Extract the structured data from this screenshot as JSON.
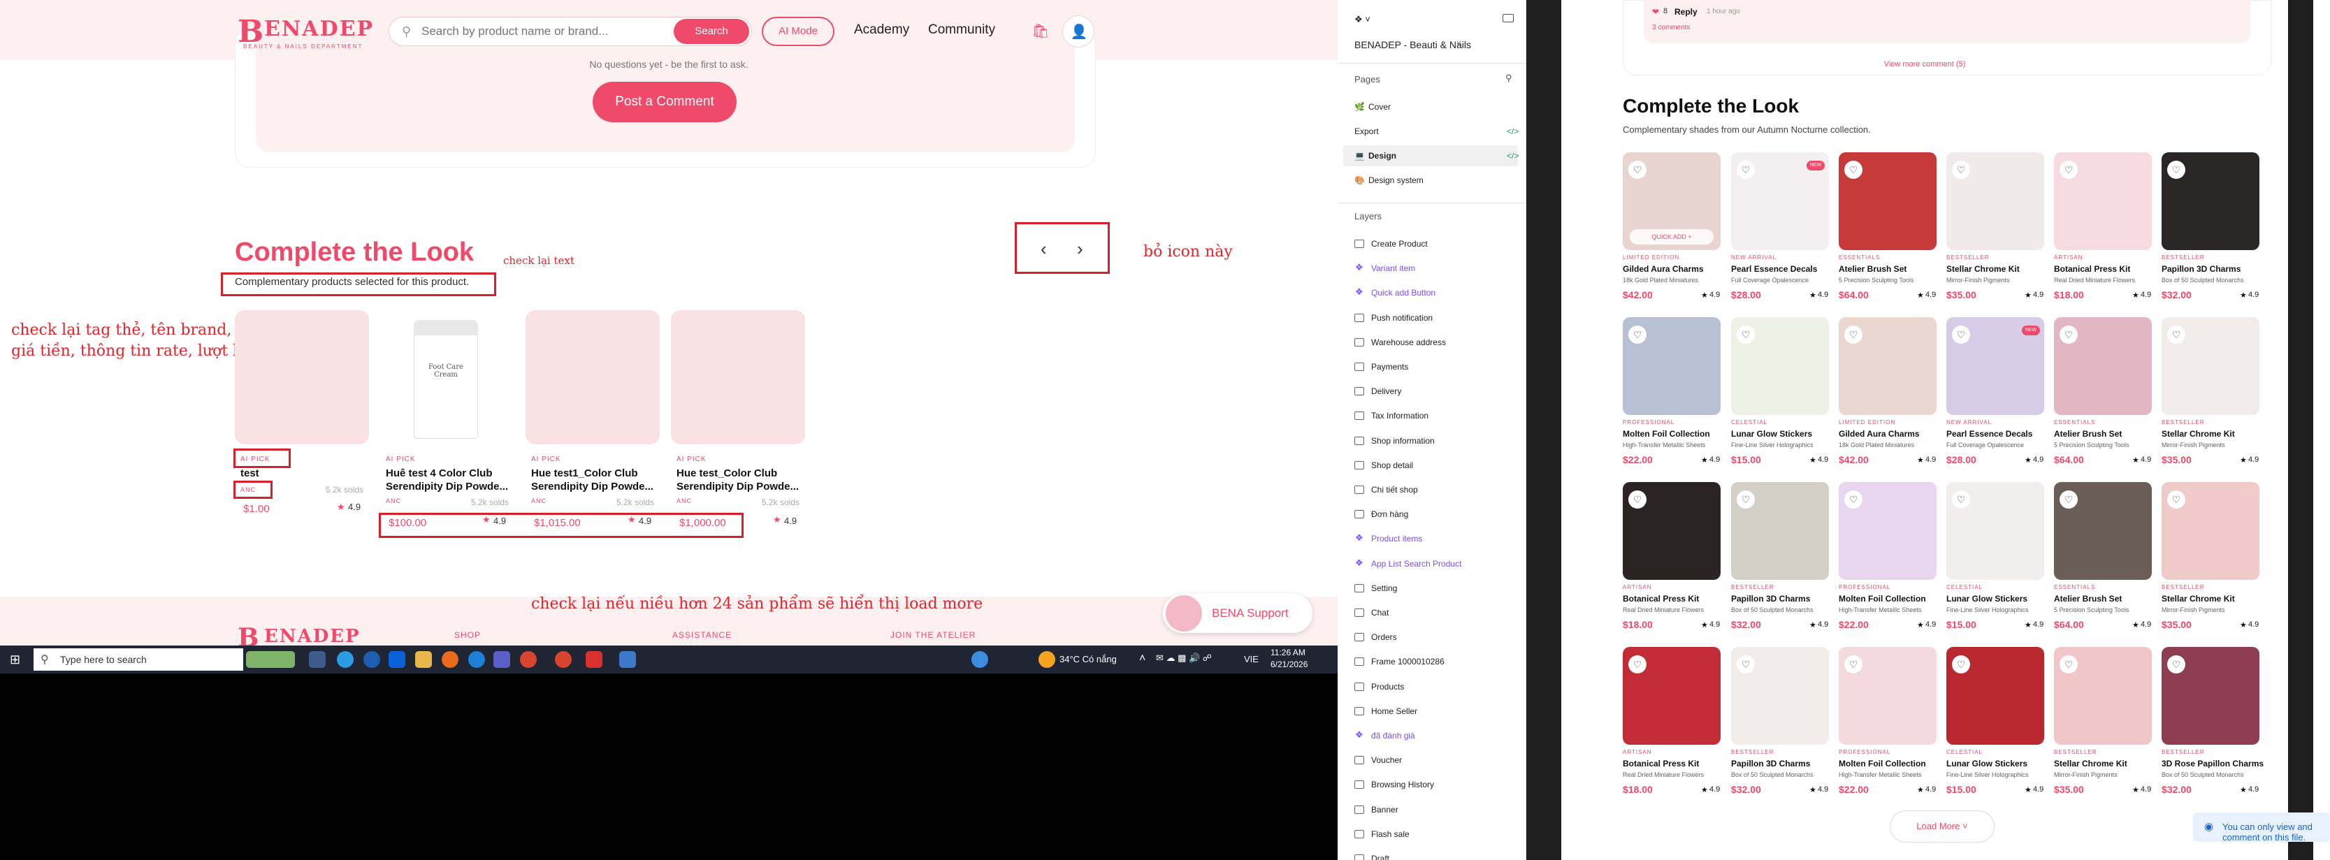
{
  "site": {
    "logo_initial": "B",
    "logo_rest": "ENADEP",
    "logo_tagline": "BEAUTY & NAILS DEPARTMENT",
    "search_placeholder": "Search by product name or brand...",
    "search_button": "Search",
    "ai_mode": "AI Mode",
    "nav": [
      "Academy",
      "Community"
    ],
    "no_comments": "No questions yet - be the first to ask.",
    "post_comment": "Post a Comment",
    "section_title": "Complete the Look",
    "section_sub": "Complementary products selected for this product.",
    "support": "BENA Support",
    "footer_links": [
      "SHOP",
      "ASSISTANCE",
      "JOIN THE ATELIER"
    ],
    "products": [
      {
        "tag": "AI PICK",
        "name": "test",
        "brand": "ANC",
        "sold": "5.2k solds",
        "price": "$1.00",
        "rating": "4.9",
        "img_color": "#f9e1e4"
      },
      {
        "tag": "AI PICK",
        "name": "Huê test 4 Color Club Serendipity Dip Powde...",
        "brand": "ANC",
        "sold": "5.2k solds",
        "price": "$100.00",
        "rating": "4.9",
        "img_color": "#ffffff"
      },
      {
        "tag": "AI PICK",
        "name": "Hue test1_Color Club Serendipity Dip Powde...",
        "brand": "ANC",
        "sold": "5.2k solds",
        "price": "$1,015.00",
        "rating": "4.9",
        "img_color": "#f9e1e4"
      },
      {
        "tag": "AI PICK",
        "name": "Hue test_Color Club Serendipity Dip Powde...",
        "brand": "ANC",
        "sold": "5.2k solds",
        "price": "$1,000.00",
        "rating": "4.9",
        "img_color": "#f9e1e4"
      }
    ],
    "jar_label": "Foot Care Cream"
  },
  "notes": {
    "check_text": "check lại text",
    "remove_icon": "bỏ icon này",
    "check_tags": "check lại tag thẻ, tên brand,",
    "check_tags2": "giá tiền, thông tin rate, lượt bán",
    "load_more": "check lại nếu niều hơn 24 sản phẩm sẽ hiển thị load more"
  },
  "taskbar": {
    "search": "Type here to search",
    "weather": "34°C  Có nắng",
    "lang": "VIE",
    "time": "11:26 AM",
    "date": "6/21/2026"
  },
  "figma": {
    "file_name": "BENADEP - Beauti & Nails",
    "pages_label": "Pages",
    "pages": [
      "Cover",
      "Export",
      "Design",
      "Design system"
    ],
    "layers_label": "Layers",
    "layers": [
      {
        "name": "Create Product",
        "type": "frame"
      },
      {
        "name": "Variant item",
        "type": "component"
      },
      {
        "name": "Quick add Button",
        "type": "component"
      },
      {
        "name": "Push notification",
        "type": "frame"
      },
      {
        "name": "Warehouse address",
        "type": "frame"
      },
      {
        "name": "Payments",
        "type": "frame"
      },
      {
        "name": "Delivery",
        "type": "frame"
      },
      {
        "name": "Tax Information",
        "type": "frame"
      },
      {
        "name": "Shop information",
        "type": "frame"
      },
      {
        "name": "Shop detail",
        "type": "frame"
      },
      {
        "name": "Chi tiết shop",
        "type": "frame"
      },
      {
        "name": "Đơn hàng",
        "type": "frame"
      },
      {
        "name": "Product items",
        "type": "component"
      },
      {
        "name": "App List Search Product",
        "type": "component"
      },
      {
        "name": "Setting",
        "type": "frame"
      },
      {
        "name": "Chat",
        "type": "frame"
      },
      {
        "name": "Orders",
        "type": "frame"
      },
      {
        "name": "Frame 1000010286",
        "type": "frame"
      },
      {
        "name": "Products",
        "type": "frame"
      },
      {
        "name": "Home Seller",
        "type": "frame"
      },
      {
        "name": "đã đánh giá",
        "type": "component"
      },
      {
        "name": "Voucher",
        "type": "frame"
      },
      {
        "name": "Browsing History",
        "type": "frame"
      },
      {
        "name": "Banner",
        "type": "frame"
      },
      {
        "name": "Flash sale",
        "type": "frame"
      },
      {
        "name": "Draft",
        "type": "frame"
      }
    ]
  },
  "design": {
    "reply_count": "8",
    "reply": "Reply",
    "reply_time": "1 hour ago",
    "comments": "3 comments",
    "view_more": "View more comment (5)",
    "title": "Complete the Look",
    "subtitle": "Complementary shades from our Autumn Nocturne collection.",
    "quick_add": "QUICK ADD +",
    "load_more": "Load More",
    "toast": "You can only view and comment on this file.",
    "products": [
      {
        "tag": "LIMITED EDITION",
        "name": "Gilded Aura Charms",
        "desc": "18k Gold Plated Miniatures",
        "price": "$42.00",
        "rating": "4.9",
        "color": "#e8d5cf",
        "badge": ""
      },
      {
        "tag": "NEW ARRIVAL",
        "name": "Pearl Essence Decals",
        "desc": "Full Coverage Opalescence",
        "price": "$28.00",
        "rating": "4.9",
        "color": "#f4eff0",
        "badge": "NEW"
      },
      {
        "tag": "ESSENTIALS",
        "name": "Atelier Brush Set",
        "desc": "5 Precision Sculpting Tools",
        "price": "$64.00",
        "rating": "4.9",
        "color": "#c73a3a",
        "badge": ""
      },
      {
        "tag": "BESTSELLER",
        "name": "Stellar Chrome Kit",
        "desc": "Mirror-Finish Pigments",
        "price": "$35.00",
        "rating": "4.9",
        "color": "#f2eaea",
        "badge": ""
      },
      {
        "tag": "ARTISAN",
        "name": "Botanical Press Kit",
        "desc": "Real Dried Miniature Flowers",
        "price": "$18.00",
        "rating": "4.9",
        "color": "#f6dbe0",
        "badge": ""
      },
      {
        "tag": "BESTSELLER",
        "name": "Papillon 3D Charms",
        "desc": "Box of 50 Sculpted Monarchs",
        "price": "$32.00",
        "rating": "4.9",
        "color": "#2a2626",
        "badge": ""
      },
      {
        "tag": "PROFESSIONAL",
        "name": "Molten Foil Collection",
        "desc": "High-Transfer Metallic Sheets",
        "price": "$22.00",
        "rating": "4.9",
        "color": "#b7c1d3",
        "badge": ""
      },
      {
        "tag": "CELESTIAL",
        "name": "Lunar Glow Stickers",
        "desc": "Fine-Line Silver Holographics",
        "price": "$15.00",
        "rating": "4.9",
        "color": "#eef2e6",
        "badge": ""
      },
      {
        "tag": "LIMITED EDITION",
        "name": "Gilded Aura Charms",
        "desc": "18k Gold Plated Miniatures",
        "price": "$42.00",
        "rating": "4.9",
        "color": "#ead7d0",
        "badge": ""
      },
      {
        "tag": "NEW ARRIVAL",
        "name": "Pearl Essence Decals",
        "desc": "Full Coverage Opalescence",
        "price": "$28.00",
        "rating": "4.9",
        "color": "#d7cce8",
        "badge": "NEW"
      },
      {
        "tag": "ESSENTIALS",
        "name": "Atelier Brush Set",
        "desc": "5 Precision Sculpting Tools",
        "price": "$64.00",
        "rating": "4.9",
        "color": "#e2b6c3",
        "badge": ""
      },
      {
        "tag": "BESTSELLER",
        "name": "Stellar Chrome Kit",
        "desc": "Mirror-Finish Pigments",
        "price": "$35.00",
        "rating": "4.9",
        "color": "#f1ecea",
        "badge": ""
      },
      {
        "tag": "ARTISAN",
        "name": "Botanical Press Kit",
        "desc": "Real Dried Miniature Flowers",
        "price": "$18.00",
        "rating": "4.9",
        "color": "#2c2424",
        "badge": ""
      },
      {
        "tag": "BESTSELLER",
        "name": "Papillon 3D Charms",
        "desc": "Box of 50 Sculpted Monarchs",
        "price": "$32.00",
        "rating": "4.9",
        "color": "#d4d0c8",
        "badge": ""
      },
      {
        "tag": "PROFESSIONAL",
        "name": "Molten Foil Collection",
        "desc": "High-Transfer Metallic Sheets",
        "price": "$22.00",
        "rating": "4.9",
        "color": "#e8d6ef",
        "badge": ""
      },
      {
        "tag": "CELESTIAL",
        "name": "Lunar Glow Stickers",
        "desc": "Fine-Line Silver Holographics",
        "price": "$15.00",
        "rating": "4.9",
        "color": "#f3eeee",
        "badge": ""
      },
      {
        "tag": "ESSENTIALS",
        "name": "Atelier Brush Set",
        "desc": "5 Precision Sculpting Tools",
        "price": "$64.00",
        "rating": "4.9",
        "color": "#6b5e58",
        "badge": ""
      },
      {
        "tag": "BESTSELLER",
        "name": "Stellar Chrome Kit",
        "desc": "Mirror-Finish Pigments",
        "price": "$35.00",
        "rating": "4.9",
        "color": "#f0c9c9",
        "badge": ""
      },
      {
        "tag": "ARTISAN",
        "name": "Botanical Press Kit",
        "desc": "Real Dried Miniature Flowers",
        "price": "$18.00",
        "rating": "4.9",
        "color": "#c22c36",
        "badge": ""
      },
      {
        "tag": "BESTSELLER",
        "name": "Papillon 3D Charms",
        "desc": "Box of 50 Sculpted Monarchs",
        "price": "$32.00",
        "rating": "4.9",
        "color": "#f2ecea",
        "badge": ""
      },
      {
        "tag": "PROFESSIONAL",
        "name": "Molten Foil Collection",
        "desc": "High-Transfer Metallic Sheets",
        "price": "$22.00",
        "rating": "4.9",
        "color": "#f4d9de",
        "badge": ""
      },
      {
        "tag": "CELESTIAL",
        "name": "Lunar Glow Stickers",
        "desc": "Fine-Line Silver Holographics",
        "price": "$15.00",
        "rating": "4.9",
        "color": "#b9272f",
        "badge": ""
      },
      {
        "tag": "BESTSELLER",
        "name": "Stellar Chrome Kit",
        "desc": "Mirror-Finish Pigments",
        "price": "$35.00",
        "rating": "4.9",
        "color": "#f0c6c8",
        "badge": ""
      },
      {
        "tag": "BESTSELLER",
        "name": "3D Rose Papillon Charms",
        "desc": "Box of 50 Sculpted Monarchs",
        "price": "$32.00",
        "rating": "4.9",
        "color": "#8e3e50",
        "badge": ""
      }
    ]
  }
}
